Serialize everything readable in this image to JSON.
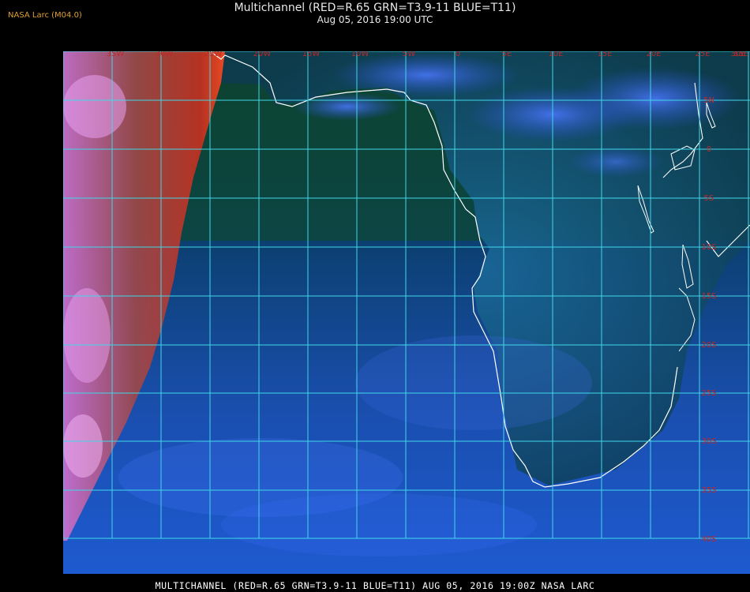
{
  "header": {
    "corner_label": "NASA Larc (M04.0)",
    "title": "Multichannel (RED=R.65 GRN=T3.9-11 BLUE=T11)",
    "subtitle": "Aug 05, 2016 19:00 UTC"
  },
  "footer": {
    "caption": "MULTICHANNEL (RED=R.65 GRN=T3.9-11 BLUE=T11) AUG 05, 2016 19:00Z    NASA LARC"
  },
  "map": {
    "grid_color": "#40d8e8",
    "coast_color": "#ffffff",
    "label_color": "#c02828",
    "longitude_labels": [
      "35W",
      "30W",
      "25W",
      "20W",
      "15W",
      "10W",
      "5W",
      "0",
      "5E",
      "10E",
      "15E",
      "20E",
      "25E",
      "30E",
      "35E"
    ],
    "latitude_labels": [
      "5N",
      "0",
      "5S",
      "10S",
      "15S",
      "20S",
      "25S",
      "30S",
      "35S",
      "40S"
    ]
  }
}
